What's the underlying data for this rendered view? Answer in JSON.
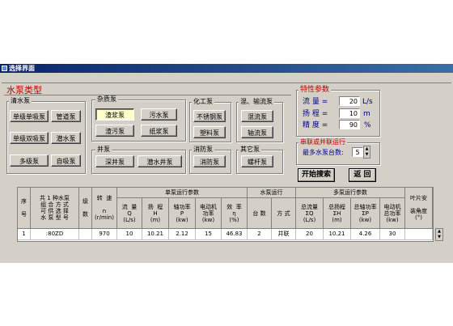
{
  "window": {
    "title": "选择界面"
  },
  "pump_type_title": "水泵类型",
  "groups": {
    "clean": {
      "legend": "清水泵",
      "buttons": [
        "单级单吸泵",
        "管道泵",
        "单级双吸泵",
        "潜水泵",
        "多级泵",
        "自吸泵"
      ]
    },
    "impurity": {
      "legend": "杂质泵",
      "buttons": [
        "渣浆泵",
        "污水泵",
        "渣污泵",
        "纸浆泵"
      ]
    },
    "well": {
      "legend": "井泵",
      "buttons": [
        "深井泵",
        "潜水井泵"
      ]
    },
    "chemical": {
      "legend": "化工泵",
      "buttons": [
        "不锈钢泵",
        "塑料泵"
      ]
    },
    "oil": {
      "legend": "混、输流泵",
      "buttons": [
        "混流泵",
        "轴流泵"
      ]
    },
    "fire": {
      "legend": "消防泵",
      "buttons": [
        "消防泵"
      ]
    },
    "other": {
      "legend": "其它泵",
      "buttons": [
        "螺杆泵"
      ]
    }
  },
  "params": {
    "title": "特性参数",
    "flow": {
      "label": "流  量 =",
      "value": "20",
      "unit": "L/s"
    },
    "head": {
      "label": "扬  程 =",
      "value": "10",
      "unit": "m"
    },
    "accuracy": {
      "label": "精  度 =",
      "value": "90",
      "unit": "%"
    }
  },
  "series": {
    "title": "串联或并联运行",
    "label": "最多水泵台数:",
    "value": "5"
  },
  "actions": {
    "search": "开始搜索",
    "back": "返 回"
  },
  "table": {
    "headers": {
      "seq": "序\n\n号",
      "desc": "共 1 种水泵\n组 合 方 式\n可 供 选 择\n水 泵 型 号",
      "stage": "级\n\n数",
      "speed": "转  速\n\nn\n(r/min)",
      "single": "单泵运行参数",
      "flow": "流  量\nQ\n(L/s)",
      "head": "扬  程\nH\n(m)",
      "shaft": "轴功率\nP\n(kw)",
      "motor": "电动机\n功率\n(kw)",
      "eff": "效  率\nη\n(%)",
      "pumprun": "水泵运行",
      "count": "台 数",
      "mode": "方  式",
      "multi": "多泵运行参数",
      "tflow": "总流量\nΣQ\n(L/s)",
      "thead": "总扬程\nΣH\n(m)",
      "tshaft": "总轴功率\nΣP\n(kw)",
      "tmotor": "电动机\n总功率\n(kw)",
      "blade": "叶片安\n\n装角度\n(°)"
    },
    "rows": [
      {
        "seq": "1",
        "model": ":80ZD",
        "stage": "",
        "speed": "970",
        "flow": "10",
        "head": "10.21",
        "shaft": "2.12",
        "motor": "15",
        "eff": "46.83",
        "count": "2",
        "mode": "并联",
        "tflow": "20",
        "thead": "10.21",
        "tshaft": "4.26",
        "tmotor": "30",
        "blade": ""
      }
    ]
  }
}
